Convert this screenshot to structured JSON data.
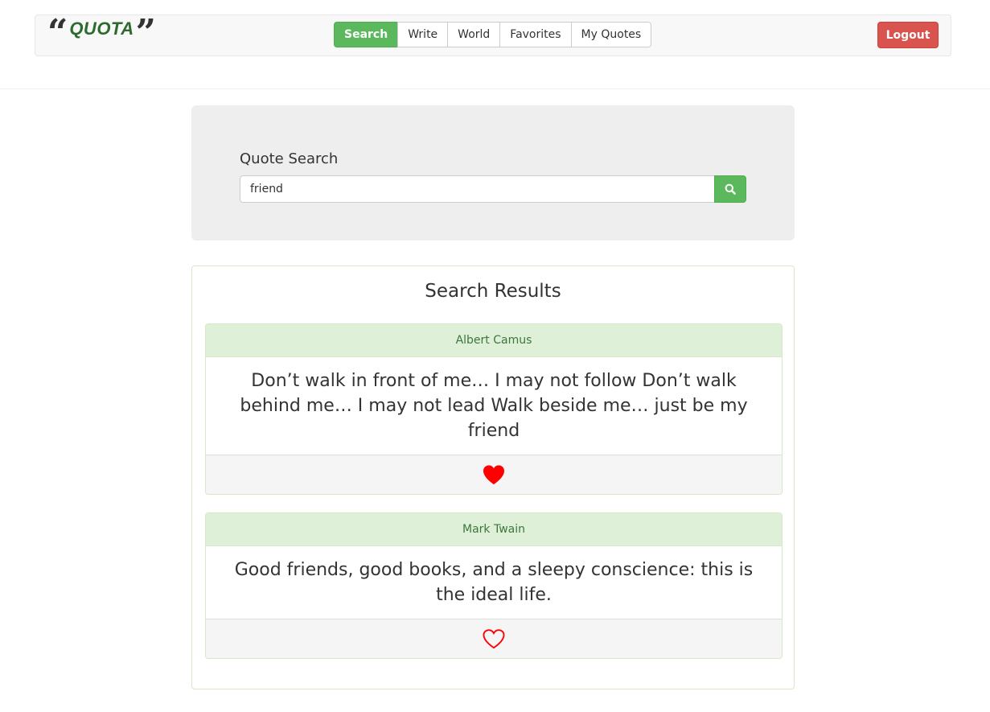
{
  "brand": {
    "open_quote": "“",
    "name": "QUOTA",
    "close_quote": "”"
  },
  "nav": {
    "tabs": [
      {
        "label": "Search",
        "active": true
      },
      {
        "label": "Write",
        "active": false
      },
      {
        "label": "World",
        "active": false
      },
      {
        "label": "Favorites",
        "active": false
      },
      {
        "label": "My Quotes",
        "active": false
      }
    ],
    "logout_label": "Logout"
  },
  "search": {
    "label": "Quote Search",
    "value": "friend",
    "button_icon": "search-icon"
  },
  "results": {
    "title": "Search Results",
    "items": [
      {
        "author": "Albert Camus",
        "quote": "Don’t walk in front of me… I may not follow Don’t walk behind me… I may not lead Walk beside me… just be my friend",
        "favorited": true,
        "icon": "heart-filled-icon"
      },
      {
        "author": "Mark Twain",
        "quote": "Good friends, good books, and a sleepy conscience: this is the ideal life.",
        "favorited": false,
        "icon": "heart-outline-icon"
      }
    ]
  },
  "colors": {
    "primary_green": "#5cb85c",
    "danger_red": "#d9534f",
    "heart_red": "#ff0000",
    "panel_header": "#dff0d8",
    "brand_green": "#2d6a2d"
  }
}
